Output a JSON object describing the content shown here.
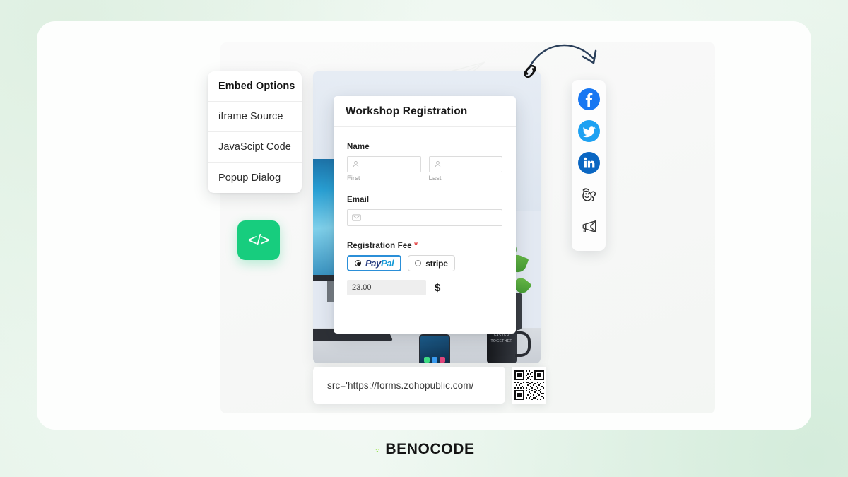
{
  "brand": {
    "name": "BENOCODE",
    "accent": "#17cd7e"
  },
  "embed_menu": {
    "items": [
      {
        "label": "Embed Options",
        "active": true
      },
      {
        "label": "iframe Source",
        "active": false
      },
      {
        "label": "JavaScipt Code",
        "active": false
      },
      {
        "label": "Popup Dialog",
        "active": false
      }
    ]
  },
  "code_button": {
    "glyph": "</>",
    "icon": "code-brackets-icon",
    "color": "#17cd7e"
  },
  "form": {
    "title": "Workshop Registration",
    "fields": {
      "name": {
        "label": "Name",
        "first": {
          "sublabel": "First",
          "value": "",
          "icon": "person-icon"
        },
        "last": {
          "sublabel": "Last",
          "value": "",
          "icon": "person-icon"
        }
      },
      "email": {
        "label": "Email",
        "value": "",
        "icon": "envelope-icon"
      },
      "registration_fee": {
        "label": "Registration Fee",
        "required_marker": "*",
        "options": [
          {
            "label": "PayPal",
            "selected": true
          },
          {
            "label": "stripe",
            "selected": false
          }
        ],
        "amount": "23.00",
        "currency_symbol": "$"
      }
    }
  },
  "url_bar": {
    "value": "src='https://forms.zohopublic.com/"
  },
  "qr_code": {
    "icon": "qr-code-icon"
  },
  "social": {
    "items": [
      {
        "name": "facebook",
        "label": "Facebook",
        "color": "#1877f2"
      },
      {
        "name": "twitter",
        "label": "Twitter",
        "color": "#1da1f2"
      },
      {
        "name": "linkedin",
        "label": "LinkedIn",
        "color": "#0a66c2"
      },
      {
        "name": "mailchimp",
        "label": "Mailchimp",
        "color": "#ffffff"
      },
      {
        "name": "email-campaign",
        "label": "Email Campaign",
        "color": "#ffffff"
      }
    ]
  },
  "decor": {
    "link_icon": "chain-link-icon",
    "arrow": "curved-arrow-icon",
    "paper_plane": "paper-plane-icon"
  },
  "photo": {
    "mug_text_line1": "FASTER",
    "mug_text_line2": "TOGETHER"
  }
}
